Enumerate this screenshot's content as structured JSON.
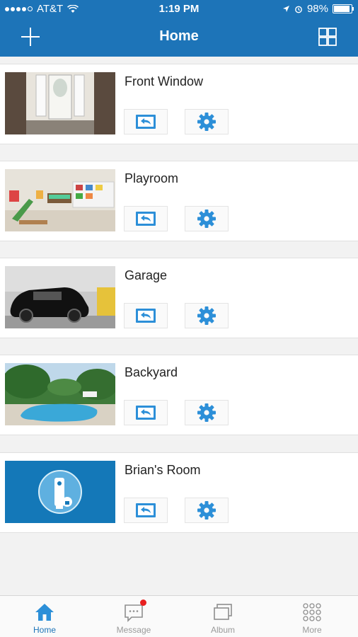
{
  "status_bar": {
    "carrier": "AT&T",
    "time": "1:19 PM",
    "battery": "98%"
  },
  "header": {
    "title": "Home"
  },
  "cameras": [
    {
      "name": "Front Window"
    },
    {
      "name": "Playroom"
    },
    {
      "name": "Garage"
    },
    {
      "name": "Backyard"
    },
    {
      "name": "Brian's Room"
    }
  ],
  "tabs": [
    {
      "label": "Home"
    },
    {
      "label": "Message"
    },
    {
      "label": "Album"
    },
    {
      "label": "More"
    }
  ],
  "colors": {
    "brand": "#1d74b8",
    "icon_blue": "#2c8fd8",
    "badge": "#e82020"
  }
}
